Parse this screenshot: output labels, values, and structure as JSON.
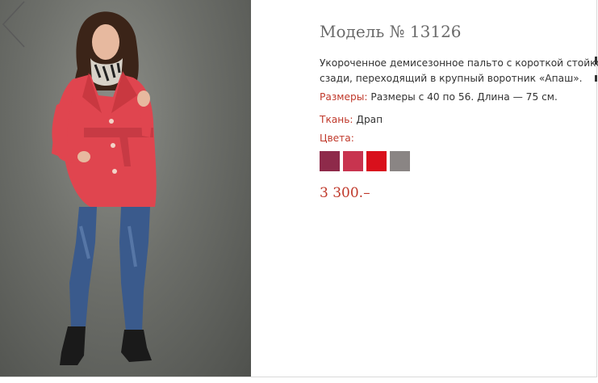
{
  "product": {
    "title": "Модель № 13126",
    "description_line1": "Укороченное демисезонное пальто с короткой стойкой",
    "description_line2": "сзади, переходящий в крупный воротник «Апаш».",
    "sizes_label": "Размеры:",
    "sizes_value": "Размеры с 40 по 56. Длина — 75 см.",
    "fabric_label": "Ткань:",
    "fabric_value": "Драп",
    "colors_label": "Цвета:",
    "price": "3 300.–"
  },
  "swatches": [
    {
      "name": "plum",
      "color": "#8e2a4a"
    },
    {
      "name": "raspberry",
      "color": "#c8344f"
    },
    {
      "name": "red",
      "color": "#d9101c"
    },
    {
      "name": "grey",
      "color": "#8a8584"
    }
  ],
  "colors": {
    "accent": "#c0392b",
    "coat": "#e0454f"
  },
  "icons": {
    "prev": "chevron-left-icon"
  }
}
